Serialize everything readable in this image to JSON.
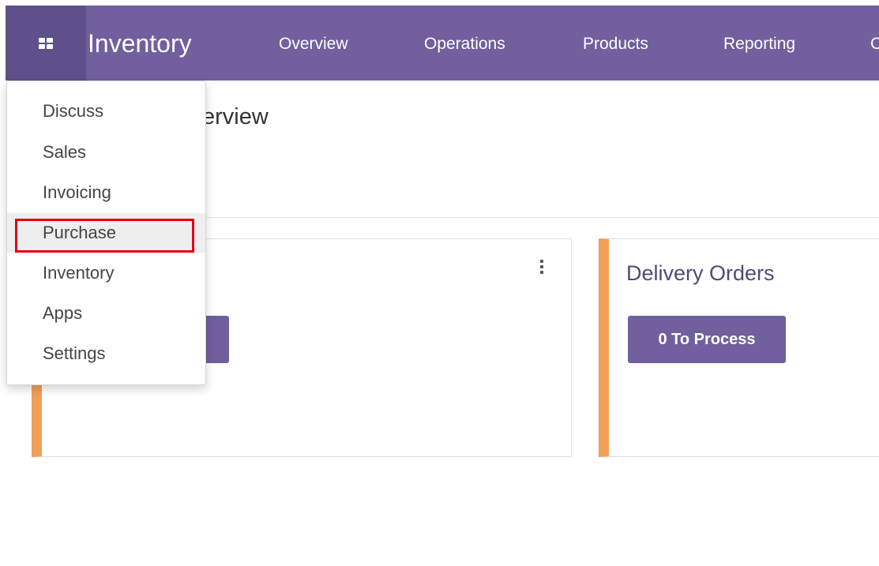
{
  "navbar": {
    "brand": "Inventory",
    "menu": [
      "Overview",
      "Operations",
      "Products",
      "Reporting",
      "C"
    ],
    "apps_icon": "grid-icon",
    "color": "#715f9e"
  },
  "page": {
    "title_partial": "erview"
  },
  "dropdown": {
    "items": [
      "Discuss",
      "Sales",
      "Invoicing",
      "Purchase",
      "Inventory",
      "Apps",
      "Settings"
    ],
    "active_index": 3,
    "highlight_color": "#e3000f"
  },
  "cards": [
    {
      "title": "",
      "button_label": "",
      "accent": "#f0a058",
      "menu_icon": "kebab-menu-icon"
    },
    {
      "title": "Delivery Orders",
      "button_label": "0 To Process",
      "accent": "#f0a058"
    }
  ]
}
